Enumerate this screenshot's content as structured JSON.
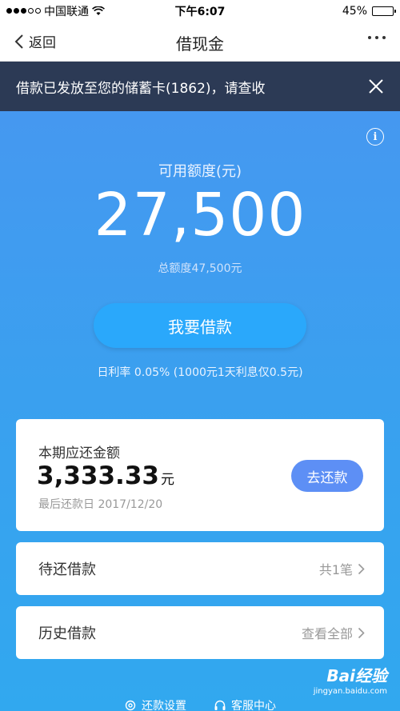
{
  "status_bar": {
    "carrier": "中国联通",
    "time": "下午6:07",
    "battery": "45%",
    "battery_level": 0.45
  },
  "nav": {
    "back_label": "返回",
    "title": "借现金"
  },
  "notice": {
    "text": "借款已发放至您的储蓄卡(1862)，请查收"
  },
  "credit": {
    "available_label": "可用额度(元)",
    "available_amount": "27,500",
    "total_text": "总额度47,500元"
  },
  "borrow_button": {
    "label": "我要借款"
  },
  "rate_text": "日利率 0.05% (1000元1天利息仅0.5元)",
  "due_card": {
    "label": "本期应还金额",
    "amount": "3,333.33",
    "unit": "元",
    "date_text": "最后还款日 2017/12/20",
    "repay_label": "去还款"
  },
  "pending_row": {
    "label": "待还借款",
    "value": "共1笔"
  },
  "history_row": {
    "label": "历史借款",
    "value": "查看全部"
  },
  "footer": {
    "settings_label": "还款设置",
    "service_label": "客服中心"
  },
  "watermark": {
    "main": "Bai经验",
    "sub": "jingyan.baidu.com"
  },
  "colors": {
    "gradient_top": "#4a95f1",
    "gradient_bottom": "#31a8ef",
    "notice_bg": "#2c3a55",
    "borrow_button": "#2aa8fb",
    "repay_button": "#5d8ff5"
  }
}
